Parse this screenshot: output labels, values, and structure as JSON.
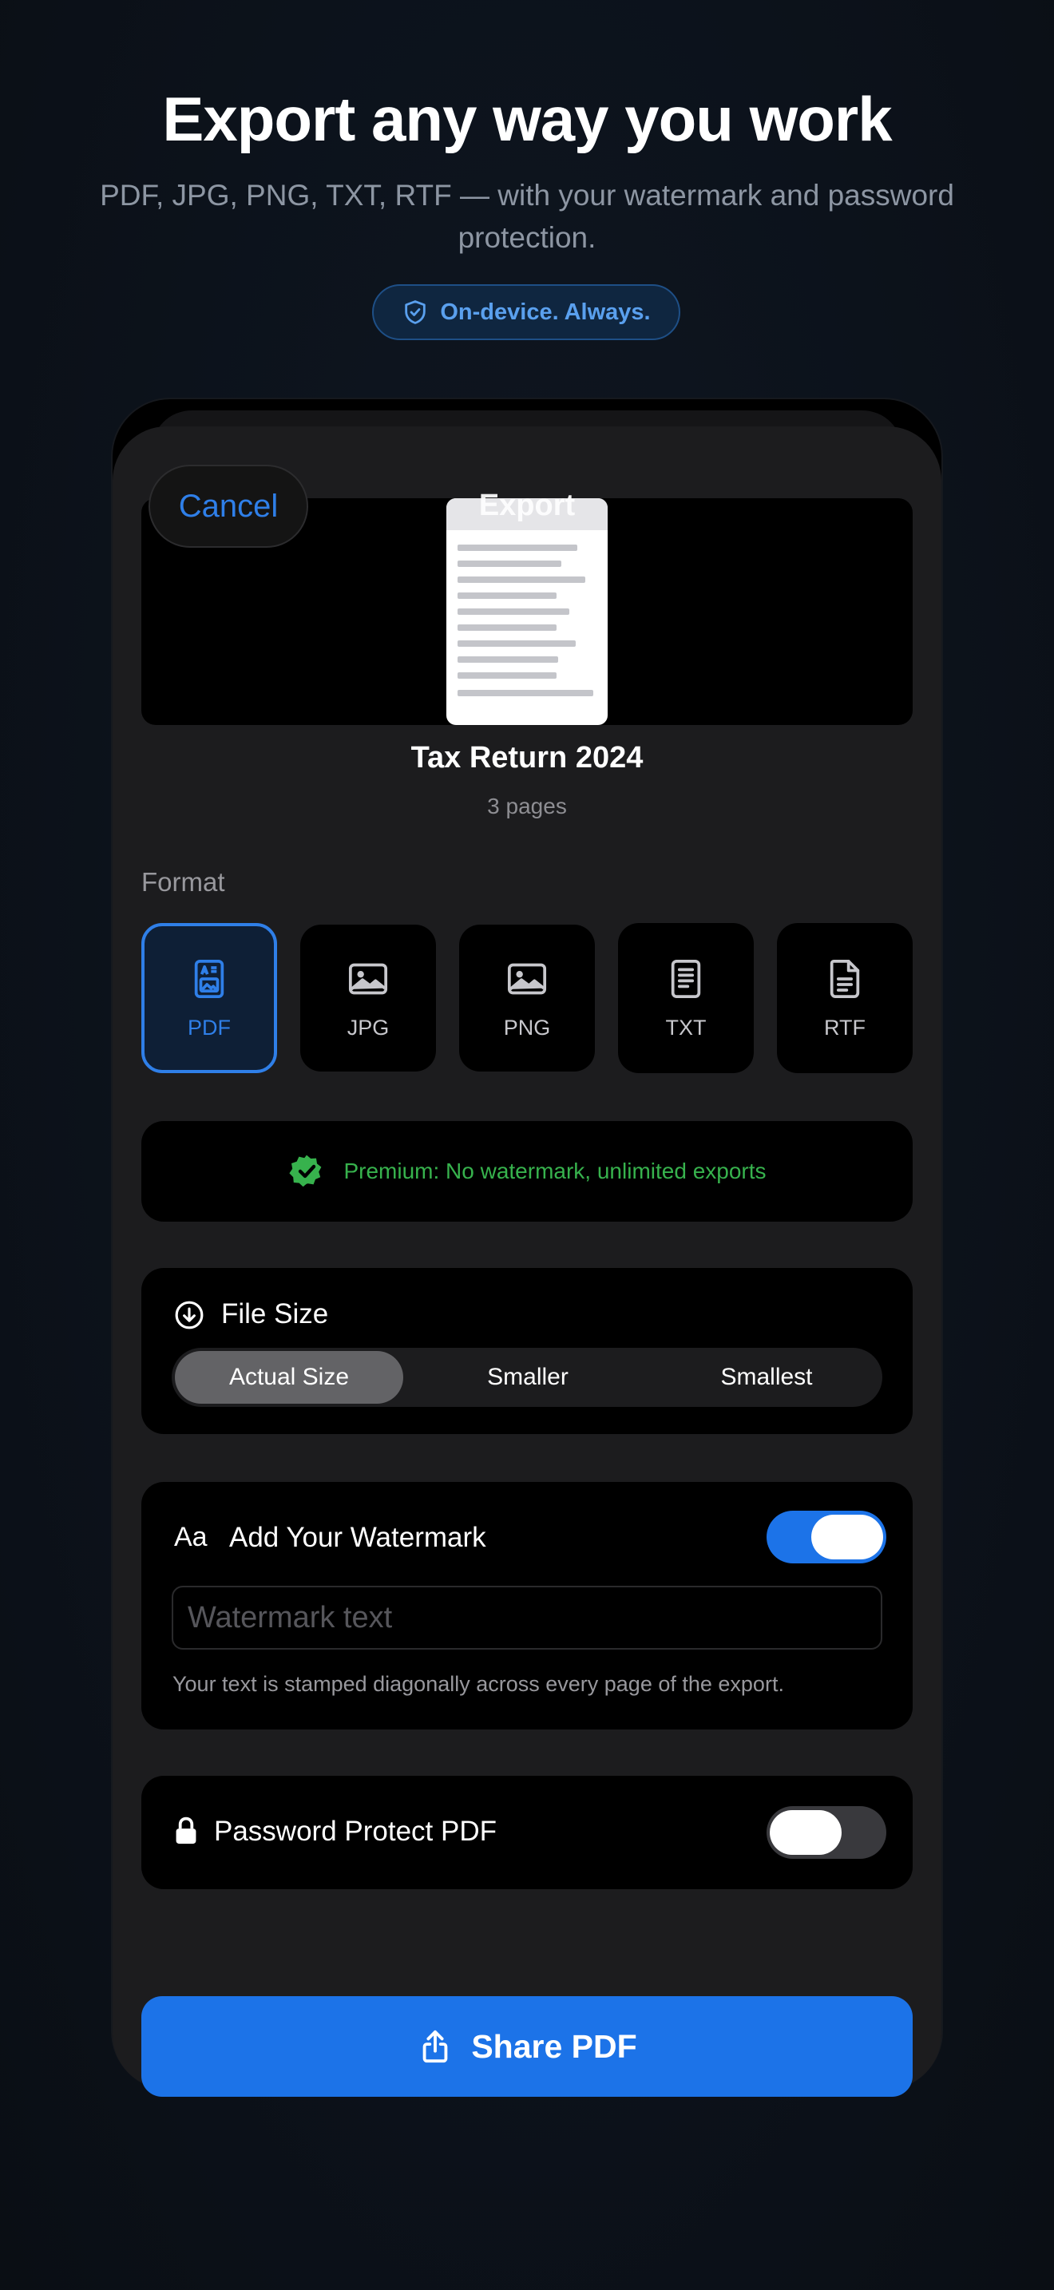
{
  "hero": {
    "title": "Export any way you work",
    "subtitle": "PDF, JPG, PNG, TXT, RTF — with your watermark and password protection.",
    "badge": "On-device. Always."
  },
  "sheet": {
    "title": "Export",
    "cancel_label": "Cancel",
    "document": {
      "name": "Tax Return 2024",
      "pages": "3 pages"
    }
  },
  "format": {
    "label": "Format",
    "options": [
      {
        "label": "PDF",
        "icon": "pdf-file-icon",
        "selected": true
      },
      {
        "label": "JPG",
        "icon": "image-icon",
        "selected": false
      },
      {
        "label": "PNG",
        "icon": "image-icon",
        "selected": false
      },
      {
        "label": "TXT",
        "icon": "text-file-icon",
        "selected": false
      },
      {
        "label": "RTF",
        "icon": "document-icon",
        "selected": false
      }
    ]
  },
  "premium": {
    "text": "Premium: No watermark, unlimited exports",
    "icon": "verified-check-icon"
  },
  "file_size": {
    "title": "File Size",
    "icon": "download-circle-icon",
    "options": [
      "Actual Size",
      "Smaller",
      "Smallest"
    ],
    "selected": "Actual Size"
  },
  "watermark": {
    "icon_label": "Aa",
    "title": "Add Your Watermark",
    "enabled": true,
    "placeholder": "Watermark text",
    "value": "",
    "hint": "Your text is stamped diagonally across every page of the export."
  },
  "password": {
    "title": "Password Protect PDF",
    "icon": "lock-icon",
    "enabled": false
  },
  "share": {
    "label": "Share PDF",
    "icon": "share-icon"
  },
  "colors": {
    "accent": "#1c73e8",
    "link": "#2f7fe8",
    "success": "#37b24d",
    "badge_text": "#5aa0ee",
    "background": "#0c121b",
    "sheet": "#1c1c1e"
  }
}
